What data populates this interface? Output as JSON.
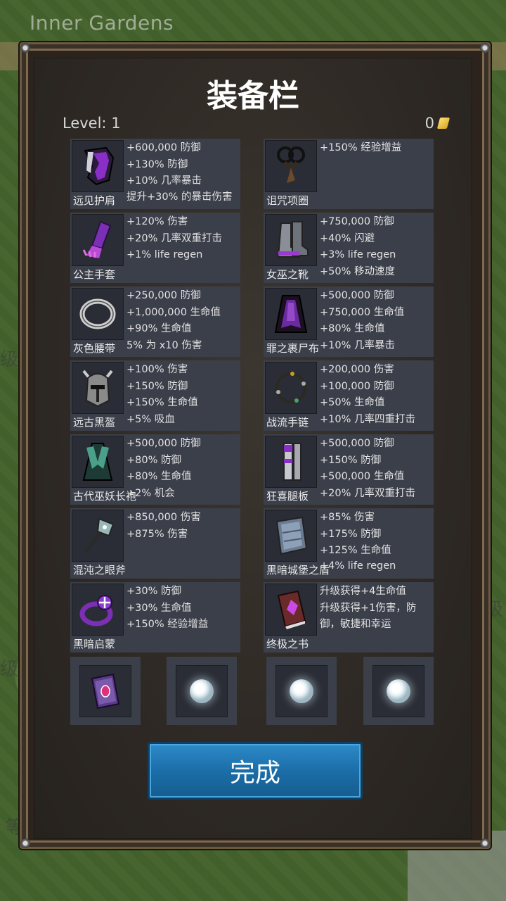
{
  "world": {
    "area_name": "Inner Gardens",
    "side_texts": [
      "级",
      "级",
      "级",
      "等"
    ]
  },
  "dialog": {
    "title": "装备栏",
    "level_label": "Level:",
    "level_value": "1",
    "gold_amount": "0",
    "done_label": "完成"
  },
  "equipment": [
    {
      "name": "远见护肩",
      "icon": "shoulder-armor-icon",
      "stats": [
        "+600,000 防御",
        "+130% 防御",
        "+10% 几率暴击",
        "提升+30% 的暴击伤害"
      ]
    },
    {
      "name": "诅咒项圈",
      "icon": "necklace-icon",
      "stats": [
        "+150% 经验增益"
      ]
    },
    {
      "name": "公主手套",
      "icon": "gloves-icon",
      "stats": [
        "+120% 伤害",
        "+20% 几率双重打击",
        "+1% life regen"
      ]
    },
    {
      "name": "女巫之靴",
      "icon": "boots-icon",
      "stats": [
        "+750,000 防御",
        "+40% 闪避",
        "+3% life regen",
        "+50% 移动速度"
      ]
    },
    {
      "name": "灰色腰带",
      "icon": "belt-icon",
      "stats": [
        "+250,000 防御",
        "+1,000,000 生命值",
        "+90% 生命值",
        "5% 为 x10 伤害"
      ]
    },
    {
      "name": "罪之裹尸布",
      "icon": "cloak-icon",
      "stats": [
        "+500,000 防御",
        "+750,000 生命值",
        "+80% 生命值",
        "+10% 几率暴击"
      ]
    },
    {
      "name": "远古黑盔",
      "icon": "helmet-icon",
      "stats": [
        "+100% 伤害",
        "+150% 防御",
        "+150% 生命值",
        "+5% 吸血"
      ]
    },
    {
      "name": "战流手链",
      "icon": "bracelet-icon",
      "stats": [
        "+200,000 伤害",
        "+100,000 防御",
        "+50% 生命值",
        "+10% 几率四重打击"
      ]
    },
    {
      "name": "古代巫妖长袍",
      "icon": "robe-icon",
      "stats": [
        "+500,000 防御",
        "+80% 防御",
        "+80% 生命值",
        "+2% 机会"
      ]
    },
    {
      "name": "狂喜腿板",
      "icon": "leg-armor-icon",
      "stats": [
        "+500,000 防御",
        "+150% 防御",
        "+500,000 生命值",
        "+20% 几率双重打击"
      ]
    },
    {
      "name": "混沌之眼斧",
      "icon": "axe-icon",
      "stats": [
        "+850,000 伤害",
        "+875% 伤害"
      ]
    },
    {
      "name": "黑暗城堡之盾",
      "icon": "shield-icon",
      "stats": [
        "+85% 伤害",
        "+175% 防御",
        "+125% 生命值",
        "+4% life regen"
      ]
    },
    {
      "name": "黑暗启蒙",
      "icon": "ring-icon",
      "stats": [
        "+30% 防御",
        "+30% 生命值",
        "+150% 经验增益"
      ]
    },
    {
      "name": "终极之书",
      "icon": "book-icon",
      "stats": [
        "升级获得+4生命值",
        "升级获得+1伤害，防御，敏捷和幸运"
      ]
    }
  ],
  "extra_slots": [
    {
      "icon": "purple-tome-icon"
    },
    {
      "icon": "pearl-orb-icon"
    },
    {
      "icon": "pearl-orb-icon"
    },
    {
      "icon": "pearl-orb-icon"
    }
  ],
  "colors": {
    "panel_bg": "#2f2a25",
    "card_bg": "#3b3f4a",
    "button_blue": "#1b6ea8",
    "accent_purple": "#7a2fb5"
  }
}
